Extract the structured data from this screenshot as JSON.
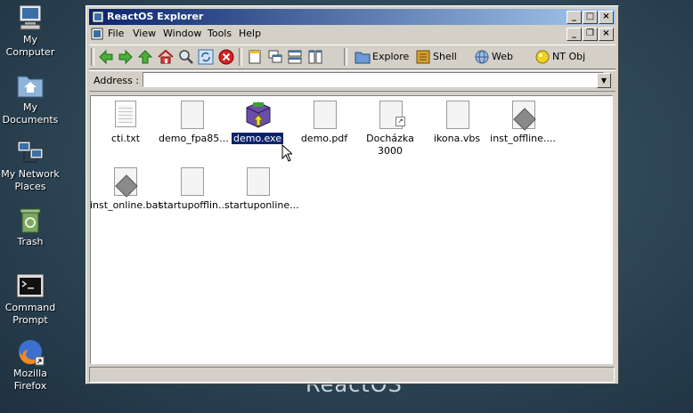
{
  "desktop": {
    "watermark": "ReactOS",
    "icons": [
      {
        "label_line1": "My",
        "label_line2": "Computer"
      },
      {
        "label_line1": "My",
        "label_line2": "Documents"
      },
      {
        "label_line1": "My Network",
        "label_line2": "Places"
      },
      {
        "label_line1": "Trash",
        "label_line2": ""
      },
      {
        "label_line1": "Command",
        "label_line2": "Prompt"
      },
      {
        "label_line1": "Mozilla",
        "label_line2": "Firefox"
      }
    ]
  },
  "window": {
    "title": "ReactOS Explorer",
    "menu": [
      "File",
      "View",
      "Window",
      "Tools",
      "Help"
    ],
    "toolbar": {
      "explore_label": "Explore",
      "shell_label": "Shell",
      "web_label": "Web",
      "ntobj_label": "NT Obj"
    },
    "address_label": "Address :",
    "address_value": "",
    "files": [
      {
        "name": "cti.txt",
        "icon": "text-file-icon"
      },
      {
        "name": "demo_fpa85...",
        "icon": "generic-file-icon"
      },
      {
        "name": "demo.exe",
        "icon": "installer-icon",
        "selected": true
      },
      {
        "name": "demo.pdf",
        "icon": "generic-file-icon"
      },
      {
        "name": "Docházka",
        "name2": "3000",
        "icon": "shortcut-file-icon"
      },
      {
        "name": "ikona.vbs",
        "icon": "generic-file-icon"
      },
      {
        "name": "inst_offline....",
        "icon": "batch-file-icon"
      },
      {
        "name": "inst_online.bat",
        "icon": "batch-file-icon"
      },
      {
        "name": "startupofflin...",
        "icon": "generic-file-icon"
      },
      {
        "name": "startuponline...",
        "icon": "generic-file-icon"
      }
    ],
    "status_text": ""
  }
}
